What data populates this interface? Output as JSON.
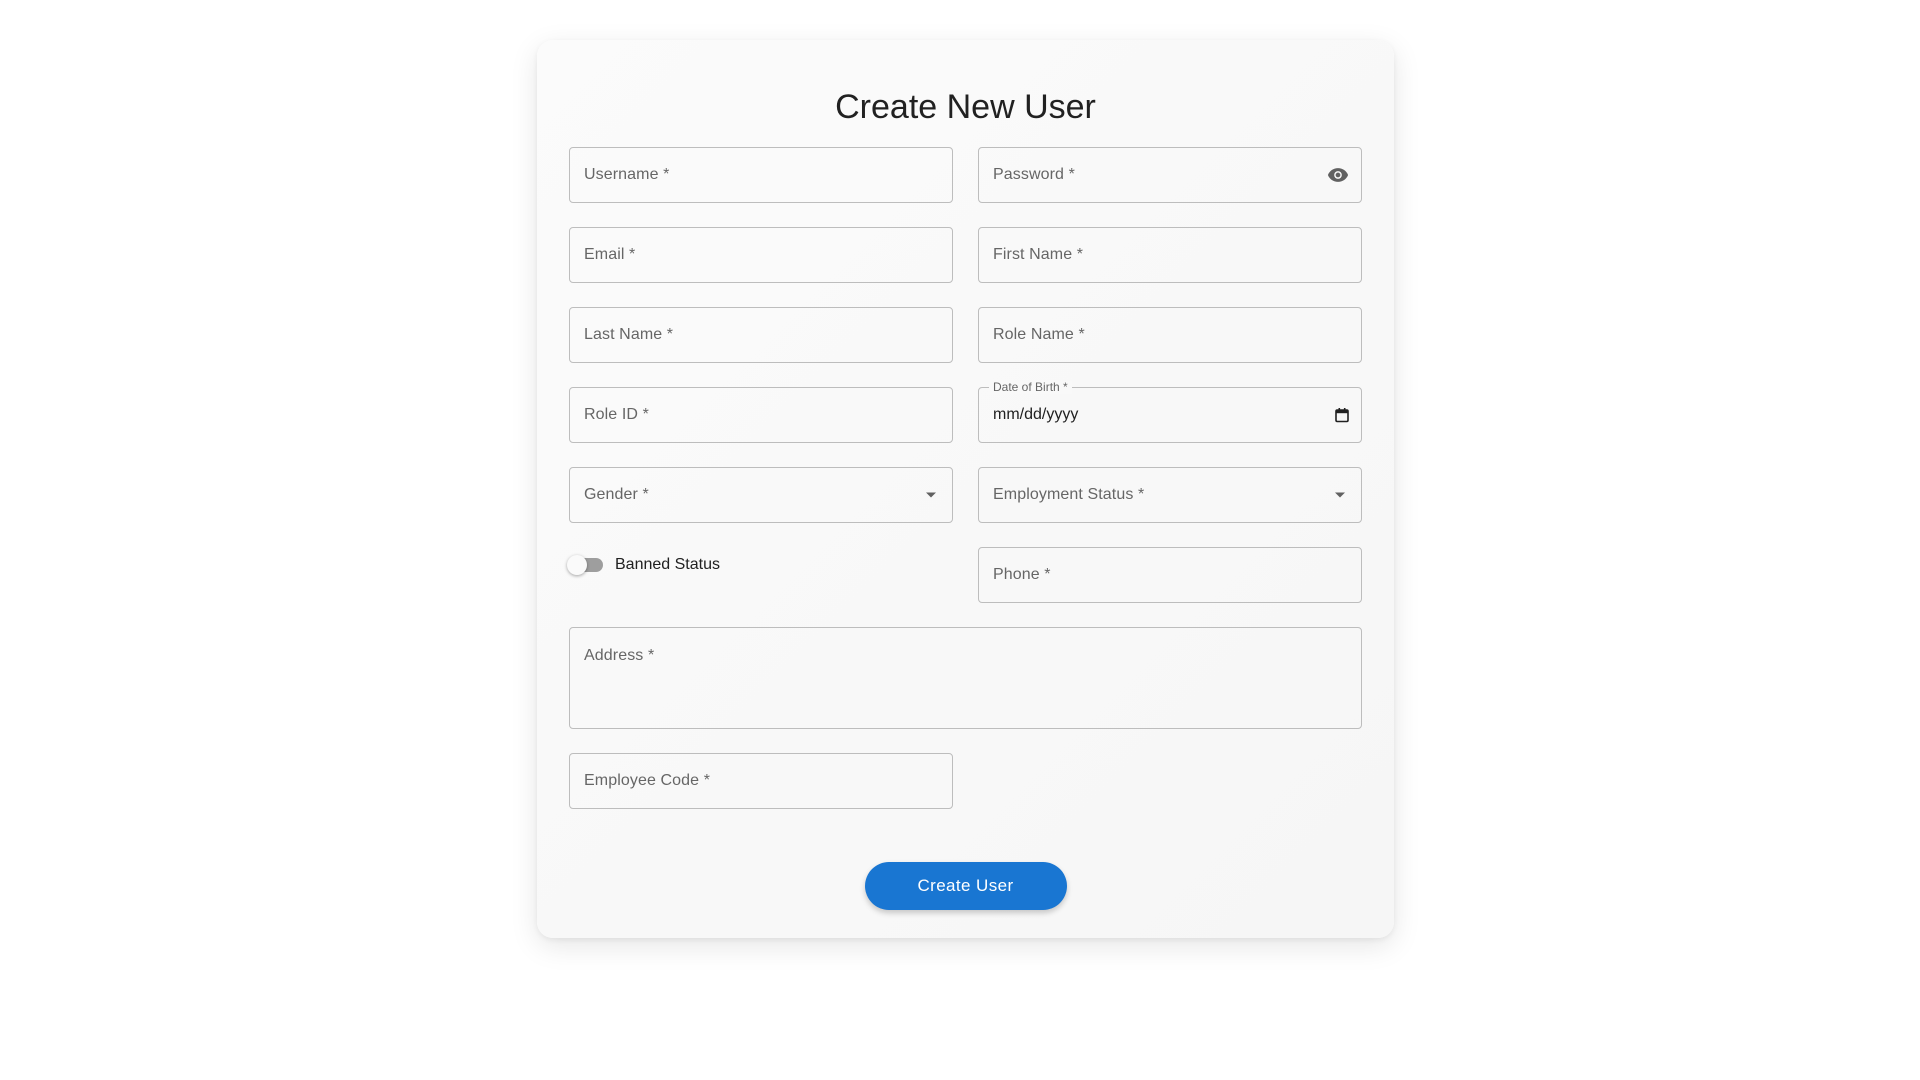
{
  "form": {
    "title": "Create New User",
    "fields": {
      "username": "Username *",
      "password": "Password *",
      "email": "Email *",
      "first_name": "First Name *",
      "last_name": "Last Name *",
      "role_name": "Role Name *",
      "role_id": "Role ID *",
      "date_of_birth_label": "Date of Birth *",
      "date_of_birth_value": "mm/dd/yyyy",
      "gender": "Gender *",
      "employment_status": "Employment Status *",
      "banned_status": "Banned Status",
      "phone": "Phone *",
      "address": "Address *",
      "employee_code": "Employee Code *"
    },
    "banned_status_on": false,
    "submit_label": "Create User"
  },
  "icons": {
    "password_toggle": "eye-icon",
    "date_picker": "calendar-icon",
    "select": "chevron-down-icon"
  },
  "colors": {
    "primary": "#1976d2",
    "border": "#bdbdbd",
    "label": "#666666"
  }
}
